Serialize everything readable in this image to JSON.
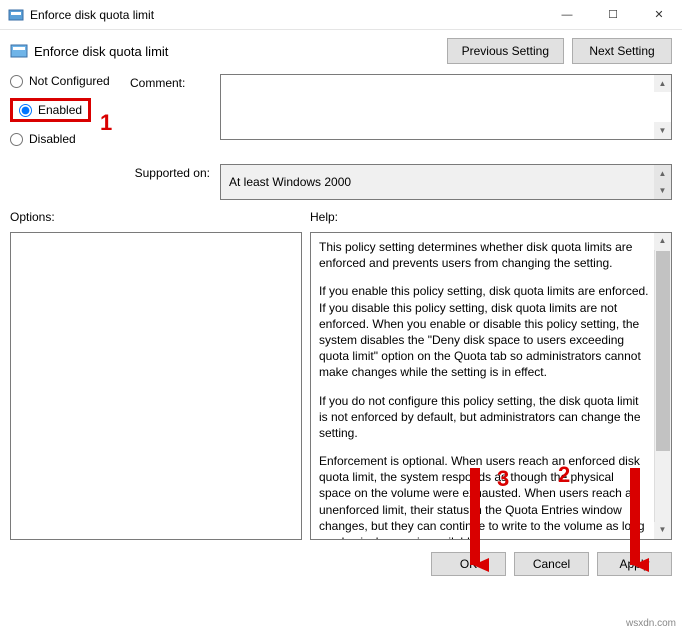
{
  "window": {
    "title": "Enforce disk quota limit",
    "min_label": "—",
    "max_label": "☐",
    "close_label": "✕"
  },
  "header": {
    "subtitle": "Enforce disk quota limit",
    "previous_btn": "Previous Setting",
    "next_btn": "Next Setting"
  },
  "radios": {
    "not_configured": "Not Configured",
    "enabled": "Enabled",
    "disabled": "Disabled"
  },
  "labels": {
    "comment": "Comment:",
    "supported_on": "Supported on:",
    "options": "Options:",
    "help": "Help:"
  },
  "supported_text": "At least Windows 2000",
  "help_paragraphs": {
    "p1": "This policy setting determines whether disk quota limits are enforced and prevents users from changing the setting.",
    "p2": "If you enable this policy setting, disk quota limits are enforced. If you disable this policy setting, disk quota limits are not enforced. When you enable or disable this policy setting, the system disables the \"Deny disk space to users exceeding quota limit\" option on the Quota tab so administrators cannot make changes while the setting is in effect.",
    "p3": "If you do not configure this policy setting, the disk quota limit is not enforced by default, but administrators can change the setting.",
    "p4": "Enforcement is optional. When users reach an enforced disk quota limit, the system responds as though the physical space on the volume were exhausted. When users reach an unenforced limit, their status in the Quota Entries window changes, but they can continue to write to the volume as long as physical space is available."
  },
  "buttons": {
    "ok": "OK",
    "cancel": "Cancel",
    "apply": "Apply"
  },
  "markers": {
    "m1": "1",
    "m2": "2",
    "m3": "3"
  },
  "footer_tag": "wsxdn.com"
}
